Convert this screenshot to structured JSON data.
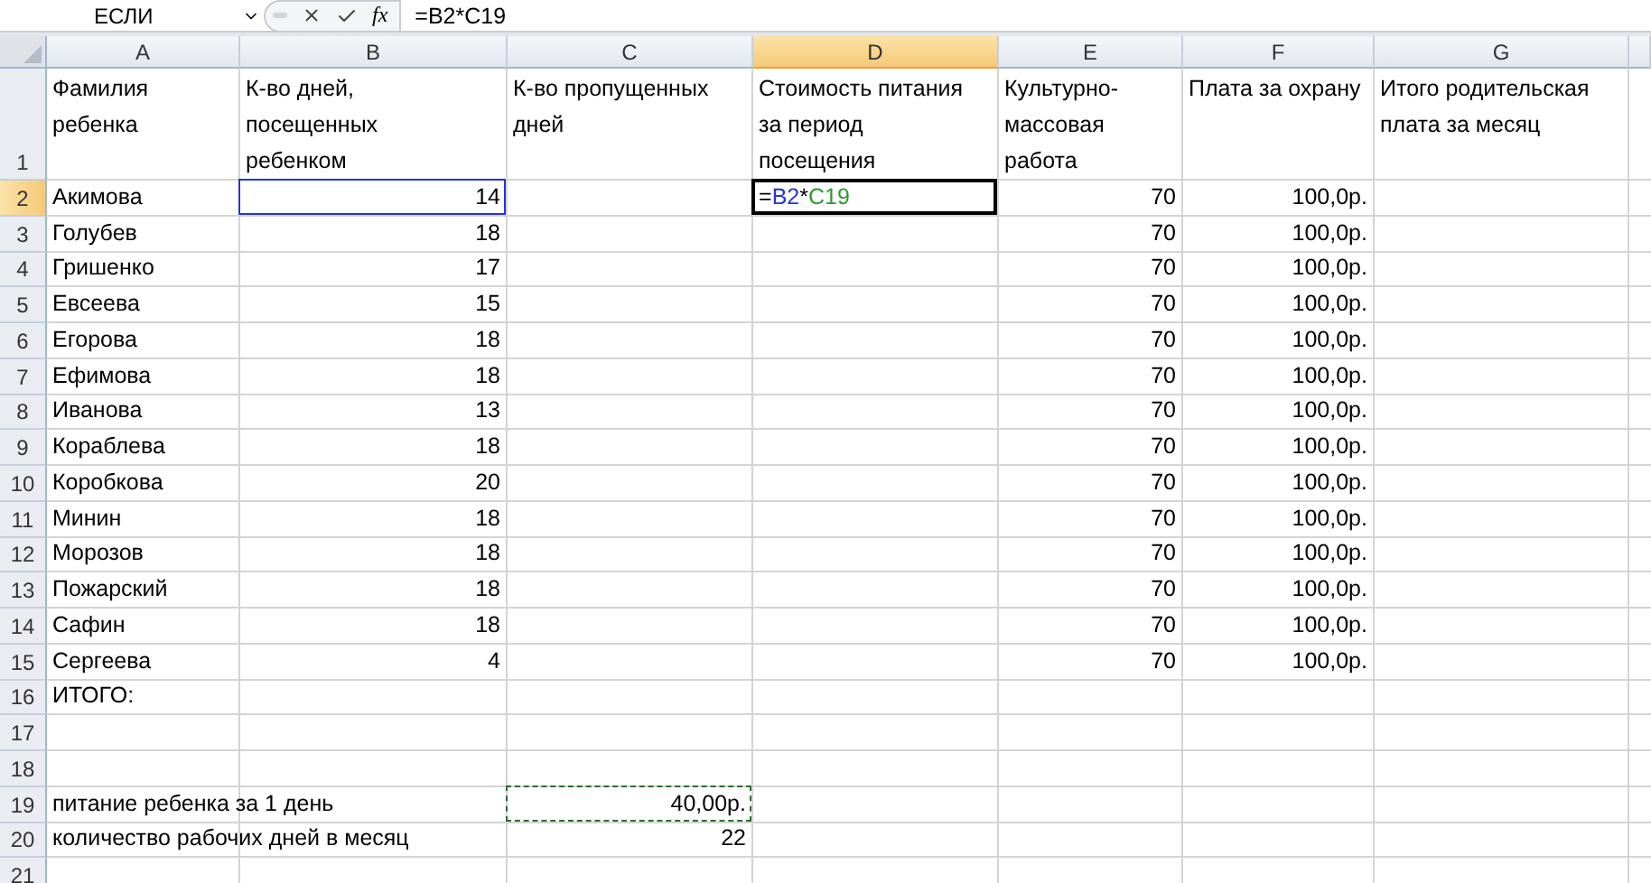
{
  "formula_bar": {
    "name_box": "ЕСЛИ",
    "function_label": "fx",
    "formula": "=B2*C19"
  },
  "columns": [
    {
      "label": "A",
      "selected": false
    },
    {
      "label": "B",
      "selected": false
    },
    {
      "label": "C",
      "selected": false
    },
    {
      "label": "D",
      "selected": true
    },
    {
      "label": "E",
      "selected": false
    },
    {
      "label": "F",
      "selected": false
    },
    {
      "label": "G",
      "selected": false
    }
  ],
  "rows": [
    {
      "number": "1",
      "selected": false,
      "kind": "header",
      "cells": [
        {
          "text": "Фамилия\nребенка",
          "kind": "text"
        },
        {
          "text": "К-во дней,\nпосещенных\nребенком",
          "kind": "text"
        },
        {
          "text": "К-во пропущенных\nдней",
          "kind": "text"
        },
        {
          "text": "Стоимость питания\nза период\nпосещения",
          "kind": "text"
        },
        {
          "text": "Культурно-\nмассовая\nработа",
          "kind": "text"
        },
        {
          "text": "Плата за охрану",
          "kind": "text"
        },
        {
          "text": "Итого родительская\nплата за месяц",
          "kind": "text"
        }
      ]
    },
    {
      "number": "2",
      "selected": true,
      "kind": "data",
      "cells": [
        {
          "text": "Акимова",
          "kind": "text"
        },
        {
          "text": "14",
          "kind": "number",
          "referenced": true
        },
        null,
        {
          "kind": "formula",
          "active": true,
          "parts": [
            {
              "text": "=",
              "color": "#000000"
            },
            {
              "text": "B2",
              "color": "#2633d6"
            },
            {
              "text": "*",
              "color": "#000000"
            },
            {
              "text": "C19",
              "color": "#2f9a2f"
            }
          ]
        },
        {
          "text": "70",
          "kind": "number"
        },
        {
          "text": "100,0р.",
          "kind": "number"
        },
        null
      ]
    },
    {
      "number": "3",
      "selected": false,
      "kind": "data",
      "cells": [
        {
          "text": "Голубев",
          "kind": "text"
        },
        {
          "text": "18",
          "kind": "number"
        },
        null,
        null,
        {
          "text": "70",
          "kind": "number"
        },
        {
          "text": "100,0р.",
          "kind": "number"
        },
        null
      ]
    },
    {
      "number": "4",
      "selected": false,
      "kind": "data",
      "cells": [
        {
          "text": "Гришенко",
          "kind": "text"
        },
        {
          "text": "17",
          "kind": "number"
        },
        null,
        null,
        {
          "text": "70",
          "kind": "number"
        },
        {
          "text": "100,0р.",
          "kind": "number"
        },
        null
      ]
    },
    {
      "number": "5",
      "selected": false,
      "kind": "data",
      "cells": [
        {
          "text": "Евсеева",
          "kind": "text"
        },
        {
          "text": "15",
          "kind": "number"
        },
        null,
        null,
        {
          "text": "70",
          "kind": "number"
        },
        {
          "text": "100,0р.",
          "kind": "number"
        },
        null
      ]
    },
    {
      "number": "6",
      "selected": false,
      "kind": "data",
      "cells": [
        {
          "text": "Егорова",
          "kind": "text"
        },
        {
          "text": "18",
          "kind": "number"
        },
        null,
        null,
        {
          "text": "70",
          "kind": "number"
        },
        {
          "text": "100,0р.",
          "kind": "number"
        },
        null
      ]
    },
    {
      "number": "7",
      "selected": false,
      "kind": "data",
      "cells": [
        {
          "text": "Ефимова",
          "kind": "text"
        },
        {
          "text": "18",
          "kind": "number"
        },
        null,
        null,
        {
          "text": "70",
          "kind": "number"
        },
        {
          "text": "100,0р.",
          "kind": "number"
        },
        null
      ]
    },
    {
      "number": "8",
      "selected": false,
      "kind": "data",
      "cells": [
        {
          "text": "Иванова",
          "kind": "text"
        },
        {
          "text": "13",
          "kind": "number"
        },
        null,
        null,
        {
          "text": "70",
          "kind": "number"
        },
        {
          "text": "100,0р.",
          "kind": "number"
        },
        null
      ]
    },
    {
      "number": "9",
      "selected": false,
      "kind": "data",
      "cells": [
        {
          "text": "Кораблева",
          "kind": "text"
        },
        {
          "text": "18",
          "kind": "number"
        },
        null,
        null,
        {
          "text": "70",
          "kind": "number"
        },
        {
          "text": "100,0р.",
          "kind": "number"
        },
        null
      ]
    },
    {
      "number": "10",
      "selected": false,
      "kind": "data",
      "cells": [
        {
          "text": "Коробкова",
          "kind": "text"
        },
        {
          "text": "20",
          "kind": "number"
        },
        null,
        null,
        {
          "text": "70",
          "kind": "number"
        },
        {
          "text": "100,0р.",
          "kind": "number"
        },
        null
      ]
    },
    {
      "number": "11",
      "selected": false,
      "kind": "data",
      "cells": [
        {
          "text": "Минин",
          "kind": "text"
        },
        {
          "text": "18",
          "kind": "number"
        },
        null,
        null,
        {
          "text": "70",
          "kind": "number"
        },
        {
          "text": "100,0р.",
          "kind": "number"
        },
        null
      ]
    },
    {
      "number": "12",
      "selected": false,
      "kind": "data",
      "cells": [
        {
          "text": "Морозов",
          "kind": "text"
        },
        {
          "text": "18",
          "kind": "number"
        },
        null,
        null,
        {
          "text": "70",
          "kind": "number"
        },
        {
          "text": "100,0р.",
          "kind": "number"
        },
        null
      ]
    },
    {
      "number": "13",
      "selected": false,
      "kind": "data",
      "cells": [
        {
          "text": "Пожарский",
          "kind": "text"
        },
        {
          "text": "18",
          "kind": "number"
        },
        null,
        null,
        {
          "text": "70",
          "kind": "number"
        },
        {
          "text": "100,0р.",
          "kind": "number"
        },
        null
      ]
    },
    {
      "number": "14",
      "selected": false,
      "kind": "data",
      "cells": [
        {
          "text": "Сафин",
          "kind": "text"
        },
        {
          "text": "18",
          "kind": "number"
        },
        null,
        null,
        {
          "text": "70",
          "kind": "number"
        },
        {
          "text": "100,0р.",
          "kind": "number"
        },
        null
      ]
    },
    {
      "number": "15",
      "selected": false,
      "kind": "data",
      "cells": [
        {
          "text": "Сергеева",
          "kind": "text"
        },
        {
          "text": "4",
          "kind": "number"
        },
        null,
        null,
        {
          "text": "70",
          "kind": "number"
        },
        {
          "text": "100,0р.",
          "kind": "number"
        },
        null
      ]
    },
    {
      "number": "16",
      "selected": false,
      "kind": "data",
      "cells": [
        {
          "text": "ИТОГО:",
          "kind": "text"
        },
        null,
        null,
        null,
        null,
        null,
        null
      ]
    },
    {
      "number": "17",
      "selected": false,
      "kind": "data",
      "cells": [
        null,
        null,
        null,
        null,
        null,
        null,
        null
      ]
    },
    {
      "number": "18",
      "selected": false,
      "kind": "data",
      "cells": [
        null,
        null,
        null,
        null,
        null,
        null,
        null
      ]
    },
    {
      "number": "19",
      "selected": false,
      "kind": "data",
      "cells": [
        {
          "text": "питание ребенка за 1 день",
          "kind": "text"
        },
        null,
        {
          "text": "40,00р.",
          "kind": "number",
          "copied": true
        },
        null,
        null,
        null,
        null
      ]
    },
    {
      "number": "20",
      "selected": false,
      "kind": "data",
      "cells": [
        {
          "text": "количество рабочих дней в месяц",
          "kind": "text"
        },
        null,
        {
          "text": "22",
          "kind": "number"
        },
        null,
        null,
        null,
        null
      ]
    },
    {
      "number": "21",
      "selected": false,
      "kind": "data",
      "cells": [
        null,
        null,
        null,
        null,
        null,
        null,
        null
      ]
    }
  ]
}
